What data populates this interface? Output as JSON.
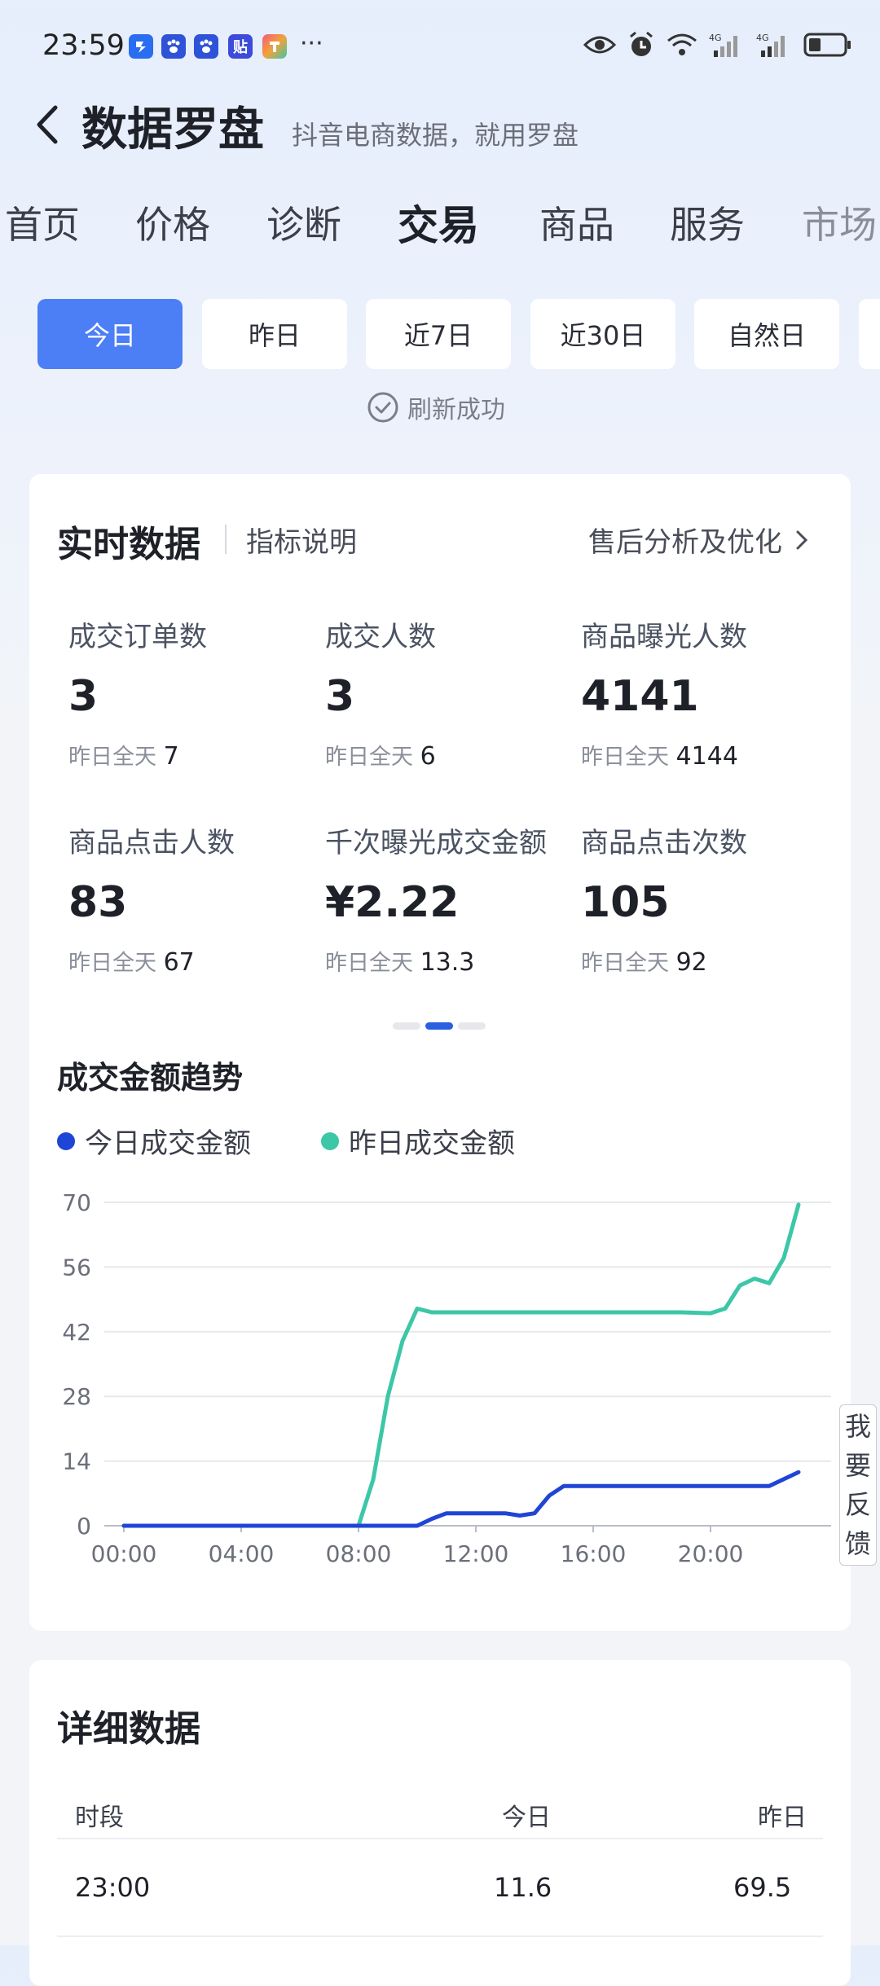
{
  "status_bar": {
    "time": "23:59",
    "apps": [
      {
        "icon": "app-square-icon",
        "label": "",
        "color": "#2a6df0"
      },
      {
        "icon": "baidu-paw-icon",
        "label": "",
        "color": "#2f53d8"
      },
      {
        "icon": "baidu-paw-icon",
        "label": "",
        "color": "#2f53d8"
      },
      {
        "icon": "tieba-icon",
        "label": "贴",
        "color": "#3c4bd9"
      },
      {
        "icon": "colorful-app-icon",
        "label": "",
        "color": "#f2a23a"
      }
    ],
    "more": "···",
    "right_icons": [
      "eye-icon",
      "alarm-icon",
      "wifi-icon",
      "signal-4g-icon",
      "signal-4g-icon",
      "battery-icon"
    ]
  },
  "header": {
    "title": "数据罗盘",
    "subtitle": "抖音电商数据，就用罗盘"
  },
  "tabs": [
    "首页",
    "价格",
    "诊断",
    "交易",
    "商品",
    "服务",
    "市场"
  ],
  "active_tab": "交易",
  "date_filters": [
    "今日",
    "昨日",
    "近7日",
    "近30日",
    "自然日",
    ""
  ],
  "active_date_filter": "今日",
  "refresh_text": "刷新成功",
  "realtime": {
    "title": "实时数据",
    "help": "指标说明",
    "link": "售后分析及优化",
    "yesterday_label": "昨日全天",
    "metrics": [
      {
        "label": "成交订单数",
        "value": "3",
        "yesterday": "7"
      },
      {
        "label": "成交人数",
        "value": "3",
        "yesterday": "6"
      },
      {
        "label": "商品曝光人数",
        "value": "4141",
        "yesterday": "4144"
      },
      {
        "label": "商品点击人数",
        "value": "83",
        "yesterday": "67"
      },
      {
        "label": "千次曝光成交金额",
        "value": "¥2.22",
        "yesterday": "13.3"
      },
      {
        "label": "商品点击次数",
        "value": "105",
        "yesterday": "92"
      }
    ],
    "page_index": 2,
    "page_count": 3
  },
  "trend": {
    "title": "成交金额趋势",
    "legend_today": "今日成交金额",
    "legend_yesterday": "昨日成交金额",
    "color_today": "#1f45d6",
    "color_yesterday": "#3cc7a7"
  },
  "chart_data": {
    "type": "line",
    "yticks": [
      0,
      14,
      28,
      42,
      56,
      70
    ],
    "ylim": [
      0,
      70
    ],
    "xticks": [
      "00:00",
      "04:00",
      "08:00",
      "12:00",
      "16:00",
      "20:00"
    ],
    "xlim": [
      0,
      23
    ],
    "series": [
      {
        "name": "今日成交金额",
        "x": [
          0,
          8,
          9,
          10,
          10.5,
          11,
          12,
          13,
          13.5,
          14,
          14.5,
          15,
          16,
          17,
          18,
          19,
          20,
          21,
          22,
          23
        ],
        "y": [
          0,
          0,
          0,
          0,
          1.5,
          2.7,
          2.7,
          2.7,
          2.2,
          2.7,
          6.5,
          8.6,
          8.6,
          8.6,
          8.6,
          8.6,
          8.6,
          8.6,
          8.6,
          11.6
        ]
      },
      {
        "name": "昨日成交金额",
        "x": [
          0,
          4,
          8,
          8.5,
          9,
          9.5,
          10,
          10.5,
          11,
          12,
          13,
          14,
          15,
          16,
          17,
          18,
          19,
          20,
          20.5,
          21,
          21.5,
          22,
          22.5,
          23
        ],
        "y": [
          0,
          0,
          0,
          10,
          28,
          40,
          47,
          46.2,
          46.2,
          46.2,
          46.2,
          46.2,
          46.2,
          46.2,
          46.2,
          46.2,
          46.2,
          46,
          47,
          52,
          53.5,
          52.5,
          58,
          69.5
        ]
      }
    ],
    "grid": true,
    "legend_position": "top-left"
  },
  "feedback": [
    "我",
    "要",
    "反",
    "馈"
  ],
  "detail": {
    "title": "详细数据",
    "columns": [
      "时段",
      "今日",
      "昨日"
    ],
    "rows": [
      {
        "period": "23:00",
        "today": "11.6",
        "yesterday": "69.5"
      }
    ]
  }
}
